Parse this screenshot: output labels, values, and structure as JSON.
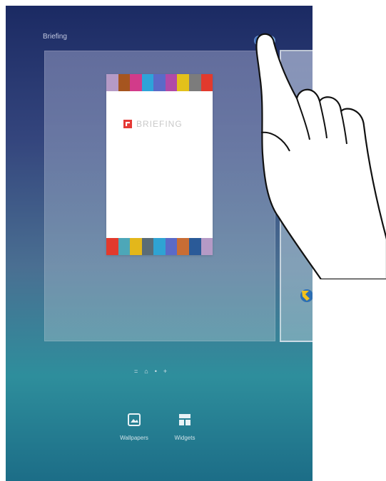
{
  "header": {
    "title": "Briefing",
    "toggle_on": true
  },
  "card": {
    "brand_text": "BRIEFING",
    "top_stripe": [
      "#b59ac6",
      "#a6551f",
      "#d23b8a",
      "#2ea3d9",
      "#5b6ac7",
      "#b14aa7",
      "#e3c11b",
      "#7c7c7c",
      "#e23a2d"
    ],
    "bottom_stripe": [
      "#e23a2d",
      "#4da7b8",
      "#e3b71b",
      "#5a6c77",
      "#2fa3d3",
      "#5b6ac7",
      "#c86d35",
      "#2a5a98",
      "#b59ac6"
    ]
  },
  "page_indicators": [
    "lines-icon",
    "home-icon",
    "dot-icon",
    "plus-icon"
  ],
  "buttons": {
    "wallpapers": "Wallpapers",
    "widgets": "Widgets"
  },
  "colors": {
    "accent": "#3d6fbd",
    "toggle_knob": "#8fd2ff"
  }
}
